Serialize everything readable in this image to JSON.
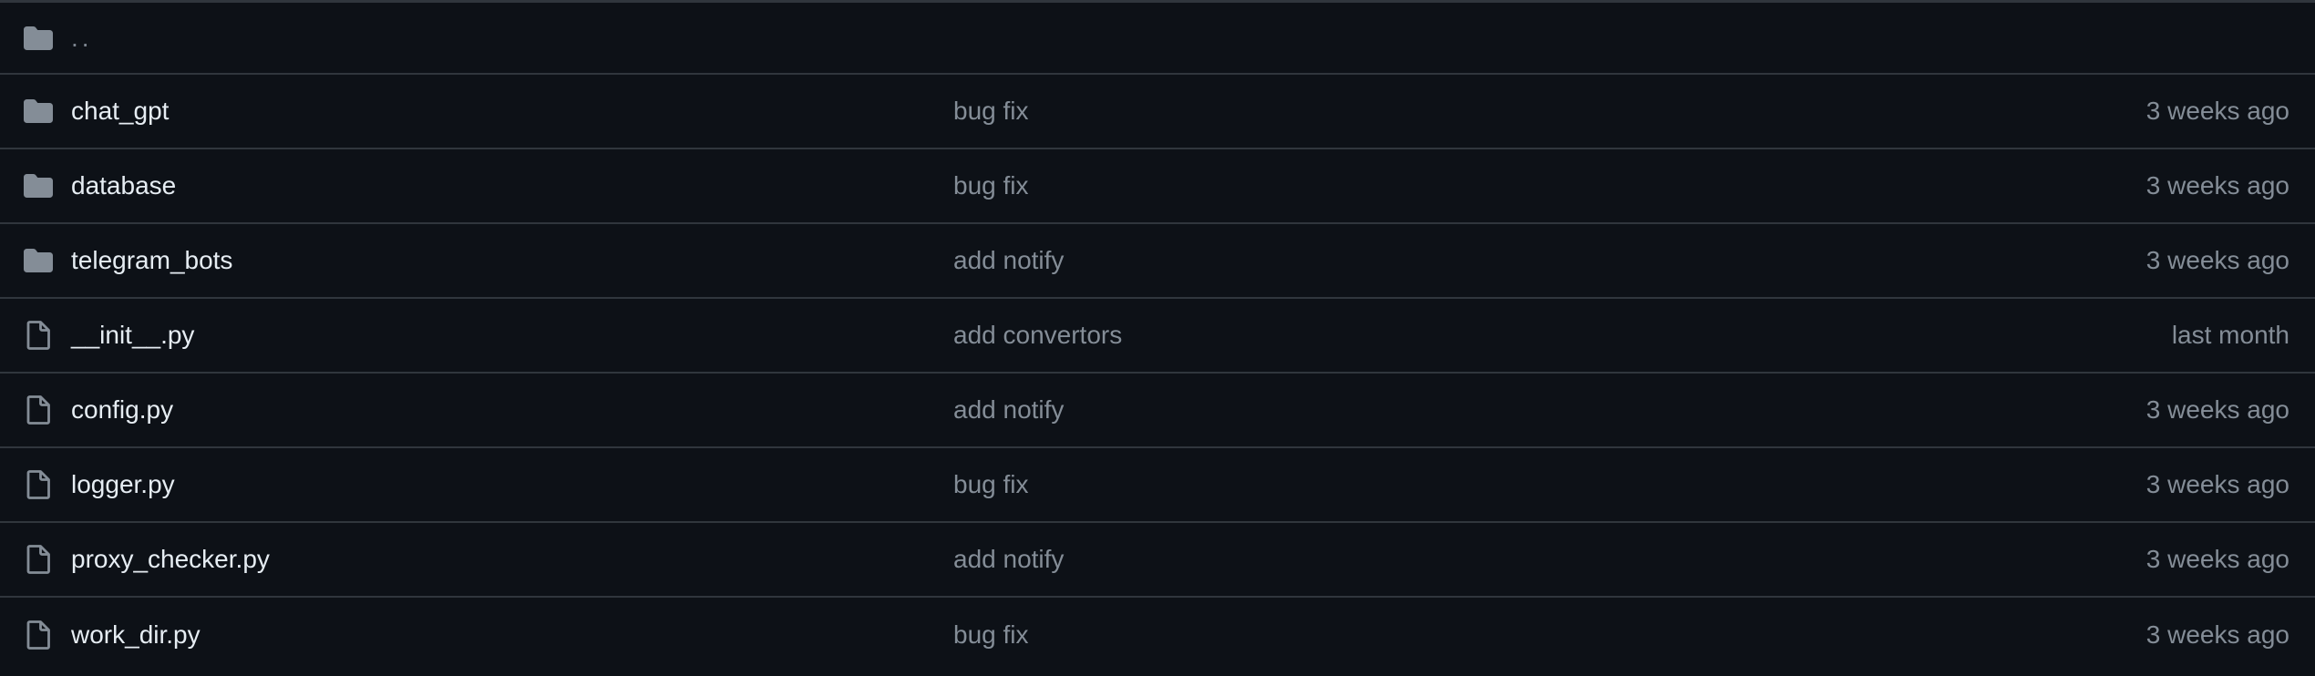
{
  "colors": {
    "background": "#0d1117",
    "border": "#30363d",
    "icon": "#848d97",
    "name_text": "#e6edf3",
    "muted_text": "#848d97"
  },
  "parent": {
    "icon": "folder-icon",
    "label": ".."
  },
  "rows": [
    {
      "type": "dir",
      "icon": "folder-icon",
      "name": "chat_gpt",
      "commit": "bug fix",
      "age": "3 weeks ago"
    },
    {
      "type": "dir",
      "icon": "folder-icon",
      "name": "database",
      "commit": "bug fix",
      "age": "3 weeks ago"
    },
    {
      "type": "dir",
      "icon": "folder-icon",
      "name": "telegram_bots",
      "commit": "add notify",
      "age": "3 weeks ago"
    },
    {
      "type": "file",
      "icon": "file-icon",
      "name": "__init__.py",
      "commit": "add convertors",
      "age": "last month"
    },
    {
      "type": "file",
      "icon": "file-icon",
      "name": "config.py",
      "commit": "add notify",
      "age": "3 weeks ago"
    },
    {
      "type": "file",
      "icon": "file-icon",
      "name": "logger.py",
      "commit": "bug fix",
      "age": "3 weeks ago"
    },
    {
      "type": "file",
      "icon": "file-icon",
      "name": "proxy_checker.py",
      "commit": "add notify",
      "age": "3 weeks ago"
    },
    {
      "type": "file",
      "icon": "file-icon",
      "name": "work_dir.py",
      "commit": "bug fix",
      "age": "3 weeks ago"
    }
  ]
}
